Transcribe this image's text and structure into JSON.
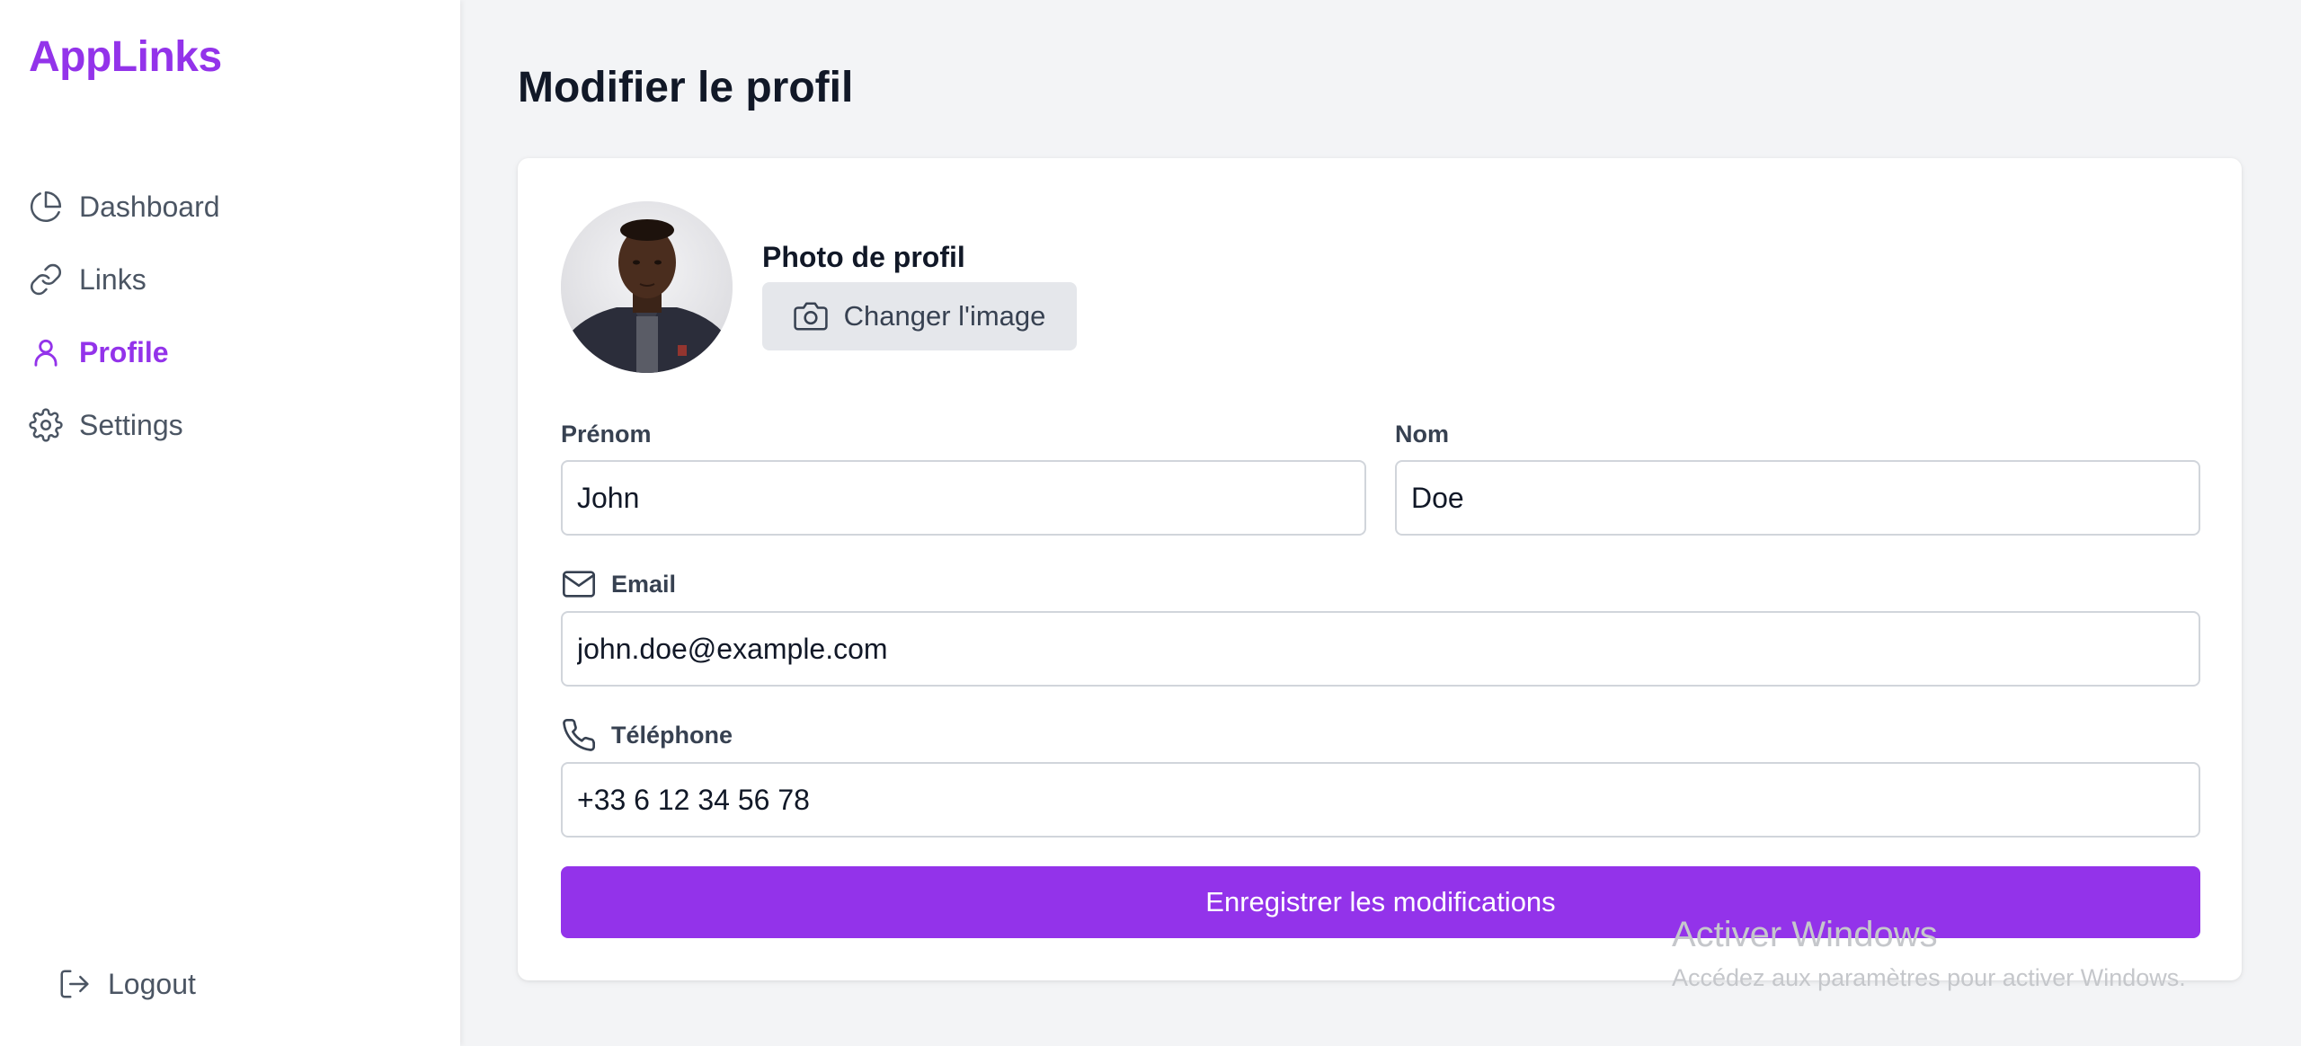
{
  "brand": "AppLinks",
  "sidebar": {
    "items": [
      {
        "label": "Dashboard",
        "icon": "pie-chart-icon"
      },
      {
        "label": "Links",
        "icon": "link-icon"
      },
      {
        "label": "Profile",
        "icon": "user-icon",
        "active": true
      },
      {
        "label": "Settings",
        "icon": "gear-icon"
      }
    ],
    "logout_label": "Logout"
  },
  "main": {
    "title": "Modifier le profil",
    "photo": {
      "label": "Photo de profil",
      "change_button": "Changer l'image"
    },
    "fields": {
      "first_name": {
        "label": "Prénom",
        "value": "John"
      },
      "last_name": {
        "label": "Nom",
        "value": "Doe"
      },
      "email": {
        "label": "Email",
        "value": "john.doe@example.com",
        "icon": "mail-icon"
      },
      "phone": {
        "label": "Téléphone",
        "value": "+33 6 12 34 56 78",
        "icon": "phone-icon"
      }
    },
    "save_button": "Enregistrer les modifications"
  },
  "watermark": {
    "line1": "Activer Windows",
    "line2": "Accédez aux paramètres pour activer Windows."
  },
  "colors": {
    "accent": "#9333ea",
    "background": "#f3f4f6",
    "card": "#ffffff"
  }
}
